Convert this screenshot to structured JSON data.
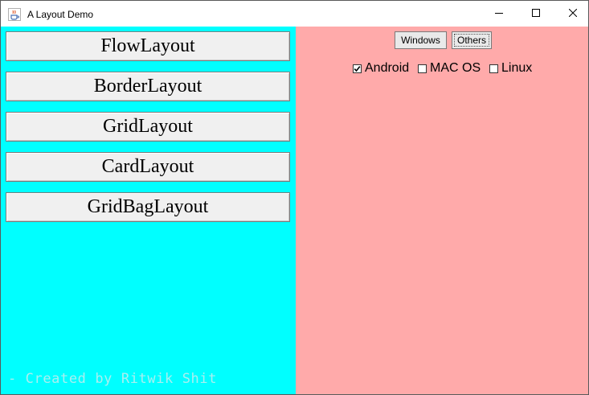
{
  "window": {
    "title": "A Layout Demo",
    "icons": {
      "app": "java-cup-icon",
      "minimize": "minimize-icon",
      "maximize": "maximize-icon",
      "close": "close-icon"
    }
  },
  "left_panel": {
    "background": "#00ffff",
    "buttons": [
      {
        "label": "FlowLayout"
      },
      {
        "label": "BorderLayout"
      },
      {
        "label": "GridLayout"
      },
      {
        "label": "CardLayout"
      },
      {
        "label": "GridBagLayout"
      }
    ],
    "credit": "- Created by Ritwik Shit"
  },
  "right_panel": {
    "background": "#ffaaaa",
    "buttons": [
      {
        "label": "Windows"
      },
      {
        "label": "Others",
        "focused": true
      }
    ],
    "checkboxes": [
      {
        "label": "Android",
        "checked": true
      },
      {
        "label": "MAC OS",
        "checked": false
      },
      {
        "label": "Linux",
        "checked": false
      }
    ]
  }
}
